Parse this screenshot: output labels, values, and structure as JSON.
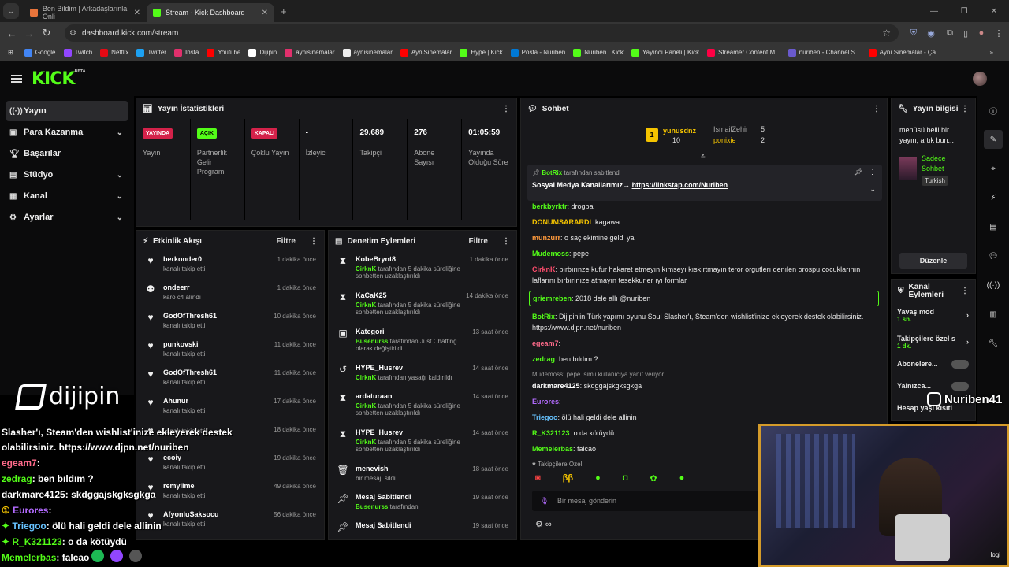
{
  "browser": {
    "tabs": [
      {
        "label": "Ben Bildim | Arkadaşlarınla Onli",
        "active": false,
        "color": "#e8743b"
      },
      {
        "label": "Stream - Kick Dashboard",
        "active": true,
        "color": "#53fc18"
      }
    ],
    "url": "dashboard.kick.com/stream",
    "bookmarks": [
      {
        "label": "Google",
        "color": "#4285f4"
      },
      {
        "label": "Twitch",
        "color": "#9146ff"
      },
      {
        "label": "Netflix",
        "color": "#e50914"
      },
      {
        "label": "Twitter",
        "color": "#1da1f2"
      },
      {
        "label": "Insta",
        "color": "#e1306c"
      },
      {
        "label": "Youtube",
        "color": "#ff0000"
      },
      {
        "label": "Dijipin",
        "color": "#ffffff"
      },
      {
        "label": "aynisinemalar",
        "color": "#e1306c"
      },
      {
        "label": "aynisinemalar",
        "color": "#eeeeee"
      },
      {
        "label": "AyniSinemalar",
        "color": "#ff0000"
      },
      {
        "label": "Hype | Kick",
        "color": "#53fc18"
      },
      {
        "label": "Posta - Nuriben",
        "color": "#0078d4"
      },
      {
        "label": "Nuriben | Kick",
        "color": "#53fc18"
      },
      {
        "label": "Yayıncı Paneli | Kick",
        "color": "#53fc18"
      },
      {
        "label": "Streamer Content M...",
        "color": "#ff0044"
      },
      {
        "label": "nuriben - Channel S...",
        "color": "#6a5acd"
      },
      {
        "label": "Aynı Sinemalar - Ça...",
        "color": "#ff0000"
      }
    ]
  },
  "sidebar": {
    "items": [
      {
        "label": "Yayın",
        "icon": "broadcast-icon",
        "chevron": false
      },
      {
        "label": "Para Kazanma",
        "icon": "wallet-icon",
        "chevron": true
      },
      {
        "label": "Başarılar",
        "icon": "trophy-icon",
        "chevron": false
      },
      {
        "label": "Stüdyo",
        "icon": "studio-icon",
        "chevron": true
      },
      {
        "label": "Kanal",
        "icon": "channel-icon",
        "chevron": true
      },
      {
        "label": "Ayarlar",
        "icon": "gear-icon",
        "chevron": true
      }
    ]
  },
  "stats": {
    "title": "Yayın İstatistikleri",
    "items": [
      {
        "badge": "YAYINDA",
        "badge_style": "red",
        "value": "",
        "label": "Yayın"
      },
      {
        "badge": "AÇIK",
        "badge_style": "green",
        "value": "",
        "label": "Partnerlik Gelir Programı"
      },
      {
        "badge": "KAPALI",
        "badge_style": "red",
        "value": "",
        "label": "Çoklu Yayın"
      },
      {
        "badge": "",
        "badge_style": "",
        "value": "-",
        "label": "İzleyici"
      },
      {
        "badge": "",
        "badge_style": "",
        "value": "29.689",
        "label": "Takipçi"
      },
      {
        "badge": "",
        "badge_style": "",
        "value": "276",
        "label": "Abone Sayısı"
      },
      {
        "badge": "",
        "badge_style": "",
        "value": "01:05:59",
        "label": "Yayında Olduğu Süre"
      }
    ]
  },
  "events": {
    "title": "Etkinlik Akışı",
    "filter": "Filtre",
    "items": [
      {
        "user": "berkonder0",
        "desc": "kanalı takip etti",
        "time": "1 dakika önce",
        "icon": "heart-icon"
      },
      {
        "user": "ondeerr",
        "desc": "karo c4 alındı",
        "time": "1 dakika önce",
        "icon": "reward-icon"
      },
      {
        "user": "GodOfThresh61",
        "desc": "kanalı takip etti",
        "time": "10 dakika önce",
        "icon": "heart-icon"
      },
      {
        "user": "punkovski",
        "desc": "kanalı takip etti",
        "time": "11 dakika önce",
        "icon": "heart-icon"
      },
      {
        "user": "GodOfThresh61",
        "desc": "kanalı takip etti",
        "time": "11 dakika önce",
        "icon": "heart-icon"
      },
      {
        "user": "Ahunur",
        "desc": "kanalı takip etti",
        "time": "17 dakika önce",
        "icon": "heart-icon"
      },
      {
        "user": "",
        "desc": "kanalı takip etti",
        "time": "18 dakika önce",
        "icon": "heart-icon"
      },
      {
        "user": "ecoiy",
        "desc": "kanalı takip etti",
        "time": "19 dakika önce",
        "icon": "heart-icon"
      },
      {
        "user": "remyiime",
        "desc": "kanalı takip etti",
        "time": "49 dakika önce",
        "icon": "heart-icon"
      },
      {
        "user": "AfyonluSaksocu",
        "desc": "kanalı takip etti",
        "time": "56 dakika önce",
        "icon": "heart-icon"
      }
    ]
  },
  "moderation": {
    "title": "Denetim Eylemleri",
    "filter": "Filtre",
    "items": [
      {
        "title": "KobeBrynt8",
        "actor": "CirknK",
        "desc": " tarafından 5 dakika süreliğine sohbetten uzaklaştırıldı",
        "time": "1 dakika önce",
        "icon": "timeout-icon"
      },
      {
        "title": "KaCaK25",
        "actor": "CirknK",
        "desc": " tarafından 5 dakika süreliğine sohbetten uzaklaştırıldı",
        "time": "14 dakika önce",
        "icon": "timeout-icon"
      },
      {
        "title": "Kategori",
        "actor": "Busenurss",
        "desc": " tarafından Just Chatting olarak değiştirildi",
        "time": "13 saat önce",
        "icon": "category-icon"
      },
      {
        "title": "HYPE_Husrev",
        "actor": "CirknK",
        "desc": " tarafından yasağı kaldırıldı",
        "time": "14 saat önce",
        "icon": "unban-icon"
      },
      {
        "title": "ardaturaan",
        "actor": "CirknK",
        "desc": " tarafından 5 dakika süreliğine sohbetten uzaklaştırıldı",
        "time": "14 saat önce",
        "icon": "timeout-icon"
      },
      {
        "title": "HYPE_Husrev",
        "actor": "CirknK",
        "desc": " tarafından 5 dakika süreliğine sohbetten uzaklaştırıldı",
        "time": "14 saat önce",
        "icon": "timeout-icon"
      },
      {
        "title": "menevish",
        "actor": "",
        "desc": "bir mesajı sildi",
        "time": "18 saat önce",
        "icon": "trash-icon"
      },
      {
        "title": "Mesaj Sabitlendi",
        "actor": "Busenurss",
        "desc": " tarafından",
        "time": "19 saat önce",
        "icon": "pin-icon"
      },
      {
        "title": "Mesaj Sabitlendi",
        "actor": "",
        "desc": "",
        "time": "19 saat önce",
        "icon": "pin-icon"
      }
    ]
  },
  "chat": {
    "title": "Sohbet",
    "top": [
      {
        "name": "yunusdnz",
        "count": "10"
      },
      {
        "name": "IsmailZehir",
        "count": "5"
      },
      {
        "name": "ponixie",
        "count": "2"
      }
    ],
    "pinned": {
      "user": "BotRix",
      "by": "tarafından sabitlendi",
      "text": "Sosyal Medya Kanallarımız→ ",
      "link": "https://linkstap.com/Nuriben"
    },
    "messages": [
      {
        "user": "berkbyrktr",
        "color": "#53fc18",
        "text": "drogba"
      },
      {
        "user": "DONUMSARARDI",
        "color": "#f5c400",
        "text": "kagawa"
      },
      {
        "user": "munzurr",
        "color": "#ff9a3c",
        "text": "o saç ekimine geldi ya"
      },
      {
        "user": "Mudemoss",
        "color": "#53fc18",
        "text": "pepe"
      },
      {
        "user": "CirknK",
        "color": "#ff4d6d",
        "text": "bırbırınze kufur hakaret etmeyın kımseyı kıskırtmayın teror orgutlerı denılen orospu cocuklarının laflarını bırbırınıze atmayın tesekkurler ıyı formlar"
      },
      {
        "user": "griemreben",
        "color": "#53fc18",
        "text": "2018 dele allı @nuriben"
      },
      {
        "user": "BotRix",
        "color": "#53fc18",
        "text": "Dijipin'in Türk yapımı oyunu Soul Slasher'ı, Steam'den wishlist'inize ekleyerek destek olabilirsiniz. https://www.djpn.net/nuriben"
      },
      {
        "user": "egeam7",
        "color": "#ff6b8b",
        "text": ""
      },
      {
        "user": "zedrag",
        "color": "#53fc18",
        "text": "ben bıldım ?"
      },
      {
        "user": "darkmare4125",
        "color": "#ffffff",
        "text": "skdggajskgksgkga"
      },
      {
        "user": "Eurores",
        "color": "#b36bff",
        "text": ""
      },
      {
        "user": "Triegoo",
        "color": "#66c2ff",
        "text": "ölü hali geldi dele allinin"
      },
      {
        "user": "R_K321123",
        "color": "#53fc18",
        "text": "o da kötüydü"
      },
      {
        "user": "Memelerbas",
        "color": "#53fc18",
        "text": "falcao"
      }
    ],
    "reply_note": "Mudemoss: pepe isimli kullanıcıya yanıt veriyor",
    "follower_only": "Takipçilere Özel",
    "placeholder": "Bir mesaj gönderin"
  },
  "streaminfo": {
    "title": "Yayın bilgisi",
    "text": "menüsü belli bir yayın, artık bun...",
    "category": "Sadece Sohbet",
    "lang": "Turkish",
    "edit": "Düzenle"
  },
  "channelactions": {
    "title": "Kanal Eylemleri",
    "items": [
      {
        "label": "Yavaş mod",
        "sub": "1 sn."
      },
      {
        "label": "Takipçilere özel s",
        "sub": "1 dk."
      },
      {
        "label": "Abonelere...",
        "sub": ""
      },
      {
        "label": "Yalnızca...",
        "sub": ""
      },
      {
        "label": "Hesap yaşı kısıtl",
        "sub": ""
      }
    ]
  },
  "overlay": {
    "brand": "dijipin",
    "lines": [
      {
        "user": "",
        "text": "Slasher'ı, Steam'den wishlist'inize ekleyerek destek",
        "color": "#ffffff"
      },
      {
        "user": "",
        "text": "olabilirsiniz. https://www.djpn.net/nuriben",
        "color": "#ffffff"
      },
      {
        "user": "egeam7",
        "text": ": ",
        "color": "#ff6b8b"
      },
      {
        "user": "zedrag",
        "text": ": ben bıldım ?",
        "color": "#53fc18"
      },
      {
        "user": "darkmare4125",
        "text": ": skdggajskgksgkga",
        "color": "#ffffff"
      },
      {
        "user": "Eurores",
        "text": ":",
        "color": "#b36bff"
      },
      {
        "user": "Triegoo",
        "text": ": ölü hali geldi dele allinin",
        "color": "#66c2ff"
      },
      {
        "user": "R_K321123",
        "text": ": o da kötüydü",
        "color": "#53fc18"
      },
      {
        "user": "Memelerbas",
        "text": ": falcao",
        "color": "#53fc18"
      }
    ],
    "handle": "Nuriben41",
    "cam_tag": "logi"
  }
}
